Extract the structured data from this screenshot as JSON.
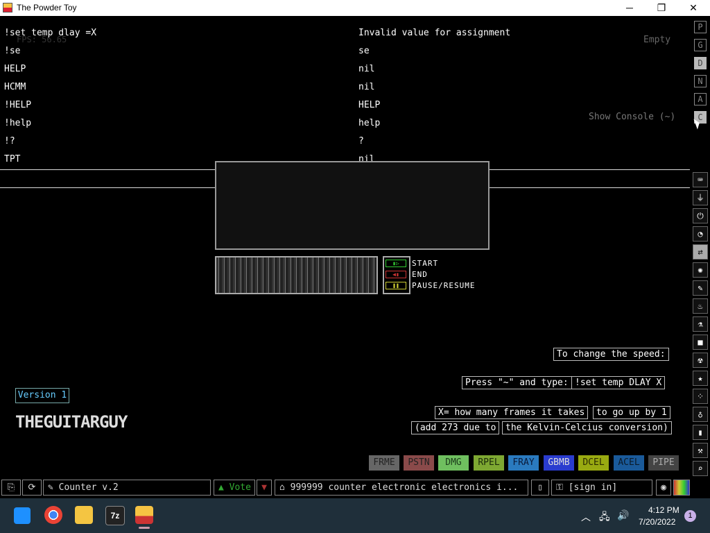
{
  "window": {
    "title": "The Powder Toy",
    "minimize_label": "─",
    "maximize_label": "❐",
    "close_label": "✕"
  },
  "console": {
    "lines": [
      {
        "cmd": "!set temp dlay =X",
        "result": "Invalid value for assignment"
      },
      {
        "cmd": "!se",
        "result": "se"
      },
      {
        "cmd": "HELP",
        "result": "nil"
      },
      {
        "cmd": "HCMM",
        "result": "nil"
      },
      {
        "cmd": "!HELP",
        "result": "HELP"
      },
      {
        "cmd": "!help",
        "result": "help"
      },
      {
        "cmd": "!?",
        "result": "?"
      },
      {
        "cmd": "TPT",
        "result": "nil"
      }
    ]
  },
  "hud": {
    "fps": "FPS: 56.65",
    "empty_label": "Empty",
    "show_console": "Show Console (~)"
  },
  "side_tabs": [
    "P",
    "G",
    "D",
    "N",
    "A",
    "C"
  ],
  "tool_icons": [
    "keyboard-icon",
    "plug-icon",
    "power-icon",
    "gauge-icon",
    "arrows-icon",
    "gear-cluster-icon",
    "brush-icon",
    "flame-icon",
    "flask-icon",
    "square-icon",
    "radiation-icon",
    "star-icon",
    "particles-icon",
    "bulb-icon",
    "bookmark-icon",
    "hammer-icon",
    "search-icon",
    "pause-icon"
  ],
  "tool_glyphs": [
    "⌨",
    "⏚",
    "⏻",
    "◔",
    "⇄",
    "✺",
    "✎",
    "♨",
    "⚗",
    "■",
    "☢",
    "★",
    "⁘",
    "♁",
    "▮",
    "⚒",
    "⌕",
    "❚❚"
  ],
  "controls": {
    "start": "START",
    "end": "END",
    "pause": "PAUSE/RESUME",
    "start_led": "▮▷",
    "end_led": "◀▮",
    "pause_led": "❚❚"
  },
  "notes": {
    "speed_title": "To change the speed:",
    "press_a": "Press \"~\" and type:",
    "press_b": "!set temp DLAY X",
    "x_a": "X= how many frames it takes",
    "x_b": "to go up by 1",
    "add_a": "(add 273 due to",
    "add_b": "the Kelvin-Celcius conversion)"
  },
  "save_info": {
    "version": "Version 1",
    "author": "THEGUITARGUY"
  },
  "elements": [
    {
      "label": "FRME",
      "bg": "#666666",
      "fg": "#222222"
    },
    {
      "label": "PSTN",
      "bg": "#8a4a4a",
      "fg": "#222222"
    },
    {
      "label": "DMG",
      "bg": "#6fbf5f",
      "fg": "#1a3a1a"
    },
    {
      "label": "RPEL",
      "bg": "#7ea832",
      "fg": "#1a2a0a"
    },
    {
      "label": "FRAY",
      "bg": "#2a7abf",
      "fg": "#0a1a3a"
    },
    {
      "label": "GBMB",
      "bg": "#2a3ccf",
      "fg": "#dddddd"
    },
    {
      "label": "DCEL",
      "bg": "#99aa11",
      "fg": "#2a2a00"
    },
    {
      "label": "ACEL",
      "bg": "#1a5a9a",
      "fg": "#0a1a2a"
    },
    {
      "label": "PIPE",
      "bg": "#444444",
      "fg": "#aaaaaa"
    }
  ],
  "bottom_bar": {
    "save_name": "Counter v.2",
    "vote": "Vote",
    "description": "999999 counter electronic electronics i...",
    "sign_in": "[sign in]"
  },
  "taskbar": {
    "apps": [
      "windows-start",
      "chrome",
      "file-explorer",
      "7zip",
      "powder-toy"
    ],
    "time": "4:12 PM",
    "date": "7/20/2022",
    "notifications": "1"
  }
}
